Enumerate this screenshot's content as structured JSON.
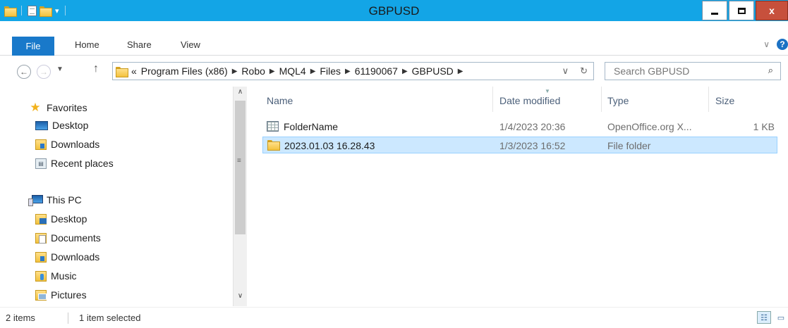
{
  "window": {
    "title": "GBPUSD"
  },
  "ribbon": {
    "tabs": [
      "File",
      "Home",
      "Share",
      "View"
    ],
    "expand_glyph": "∨",
    "help_glyph": "?"
  },
  "address": {
    "prefix": "«",
    "crumbs": [
      "Program Files (x86)",
      "Robo",
      "MQL4",
      "Files",
      "61190067",
      "GBPUSD"
    ]
  },
  "search": {
    "placeholder": "Search GBPUSD"
  },
  "nav_pane": {
    "favorites": {
      "label": "Favorites",
      "items": [
        "Desktop",
        "Downloads",
        "Recent places"
      ]
    },
    "this_pc": {
      "label": "This PC",
      "items": [
        "Desktop",
        "Documents",
        "Downloads",
        "Music",
        "Pictures"
      ]
    }
  },
  "columns": {
    "name": "Name",
    "date": "Date modified",
    "type": "Type",
    "size": "Size"
  },
  "files": [
    {
      "name": "FolderName",
      "date": "1/4/2023 20:36",
      "type": "OpenOffice.org X...",
      "size": "1 KB",
      "icon": "spreadsheet-icon",
      "selected": false
    },
    {
      "name": "2023.01.03 16.28.43",
      "date": "1/3/2023 16:52",
      "type": "File folder",
      "size": "",
      "icon": "folder-icon",
      "selected": true
    }
  ],
  "status": {
    "count": "2 items",
    "selection": "1 item selected"
  },
  "colors": {
    "titlebar": "#13a5e6",
    "file_tab": "#1979ca",
    "selection": "#cce8ff"
  }
}
